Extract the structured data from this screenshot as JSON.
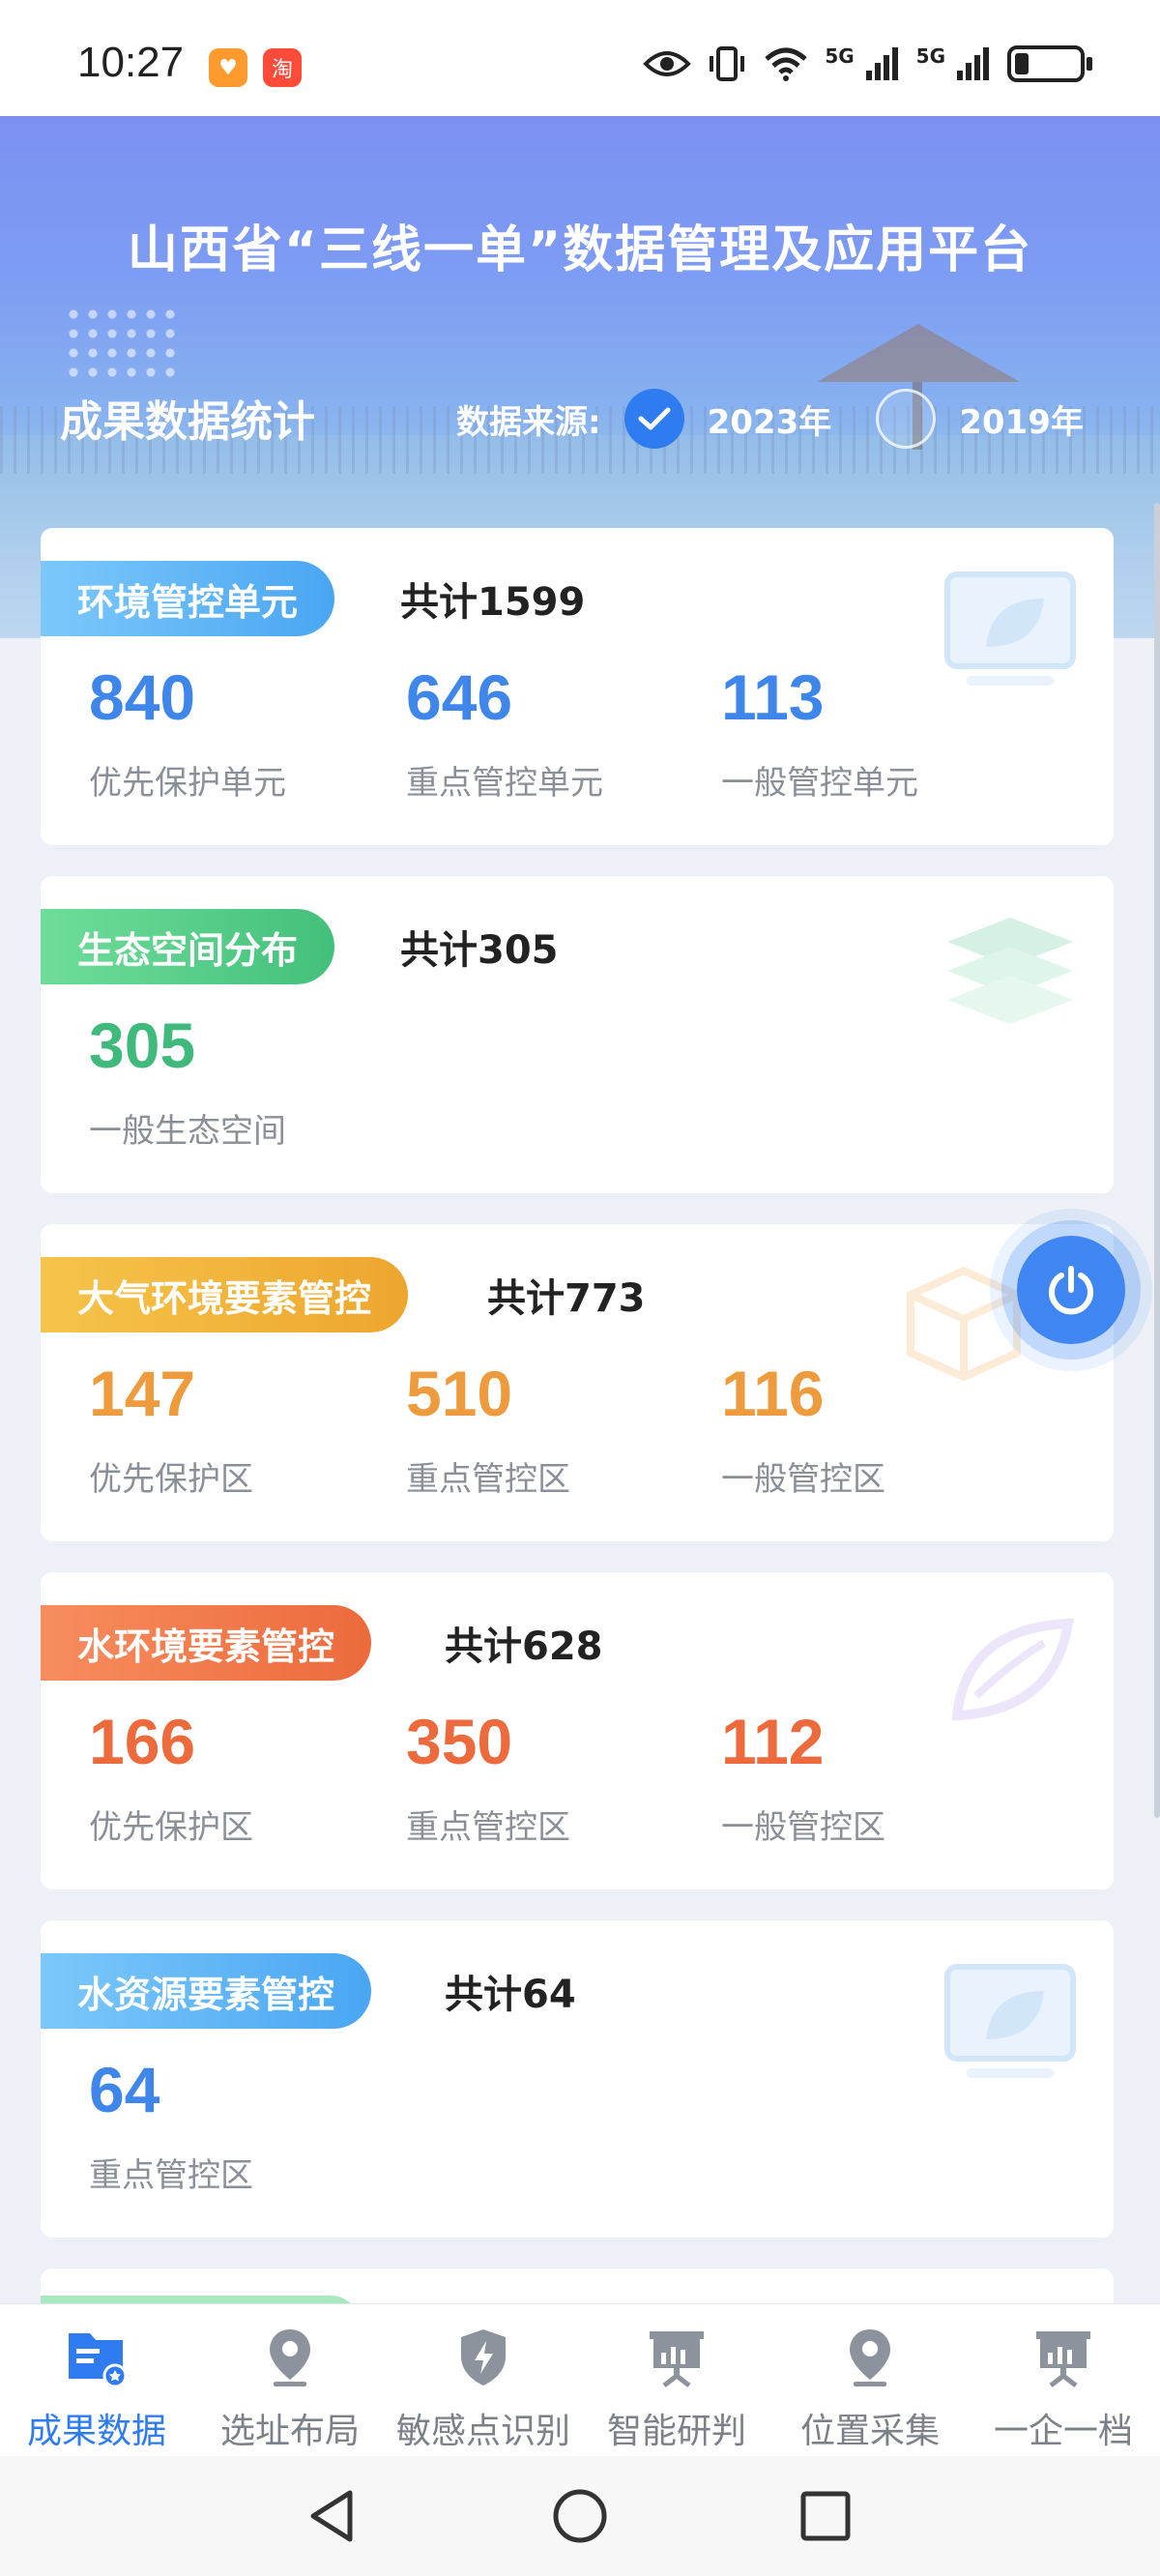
{
  "status_bar": {
    "time": "10:27",
    "network_1": "5G",
    "network_2": "5G",
    "battery_level": 0.2
  },
  "header": {
    "title": "山西省“三线一单”数据管理及应用平台",
    "section_title": "成果数据统计",
    "source_label": "数据来源:",
    "years": [
      {
        "label": "2023年",
        "selected": true
      },
      {
        "label": "2019年",
        "selected": false
      }
    ]
  },
  "cards": [
    {
      "name": "环境管控单元",
      "total": "共计1599",
      "tag_color": "#5cb6f5",
      "value_color": "#3e86ea",
      "icon": "leaf-monitor-icon",
      "stats": [
        {
          "value": "840",
          "label": "优先保护单元"
        },
        {
          "value": "646",
          "label": "重点管控单元"
        },
        {
          "value": "113",
          "label": "一般管控单元"
        }
      ]
    },
    {
      "name": "生态空间分布",
      "total": "共计305",
      "tag_color": "#5ed08e",
      "value_color": "#3fb97c",
      "icon": "layers-icon",
      "stats": [
        {
          "value": "305",
          "label": "一般生态空间"
        }
      ]
    },
    {
      "name": "大气环境要素管控",
      "total": "共计773",
      "tag_color": "#f2b93a",
      "value_color": "#ed9b3d",
      "icon": "cube-icon",
      "stats": [
        {
          "value": "147",
          "label": "优先保护区"
        },
        {
          "value": "510",
          "label": "重点管控区"
        },
        {
          "value": "116",
          "label": "一般管控区"
        }
      ]
    },
    {
      "name": "水环境要素管控",
      "total": "共计628",
      "tag_color": "#f07a4a",
      "value_color": "#ec6a3c",
      "icon": "leaf-icon",
      "stats": [
        {
          "value": "166",
          "label": "优先保护区"
        },
        {
          "value": "350",
          "label": "重点管控区"
        },
        {
          "value": "112",
          "label": "一般管控区"
        }
      ]
    },
    {
      "name": "水资源要素管控",
      "total": "共计64",
      "tag_color": "#5cb6f5",
      "value_color": "#3e86ea",
      "icon": "leaf-monitor-icon",
      "stats": [
        {
          "value": "64",
          "label": "重点管控区"
        }
      ]
    }
  ],
  "bottom_nav": [
    {
      "label": "成果数据",
      "icon": "data-folder-icon",
      "active": true
    },
    {
      "label": "选址布局",
      "icon": "location-pin-icon",
      "active": false
    },
    {
      "label": "敏感点识别",
      "icon": "shield-bolt-icon",
      "active": false
    },
    {
      "label": "智能研判",
      "icon": "presentation-board-icon",
      "active": false
    },
    {
      "label": "位置采集",
      "icon": "location-pin-icon",
      "active": false
    },
    {
      "label": "一企一档",
      "icon": "presentation-board-icon",
      "active": false
    }
  ],
  "colors": {
    "primary": "#2f7cf0",
    "nav_inactive": "#7b8089",
    "page_bg": "#edf1f7"
  }
}
